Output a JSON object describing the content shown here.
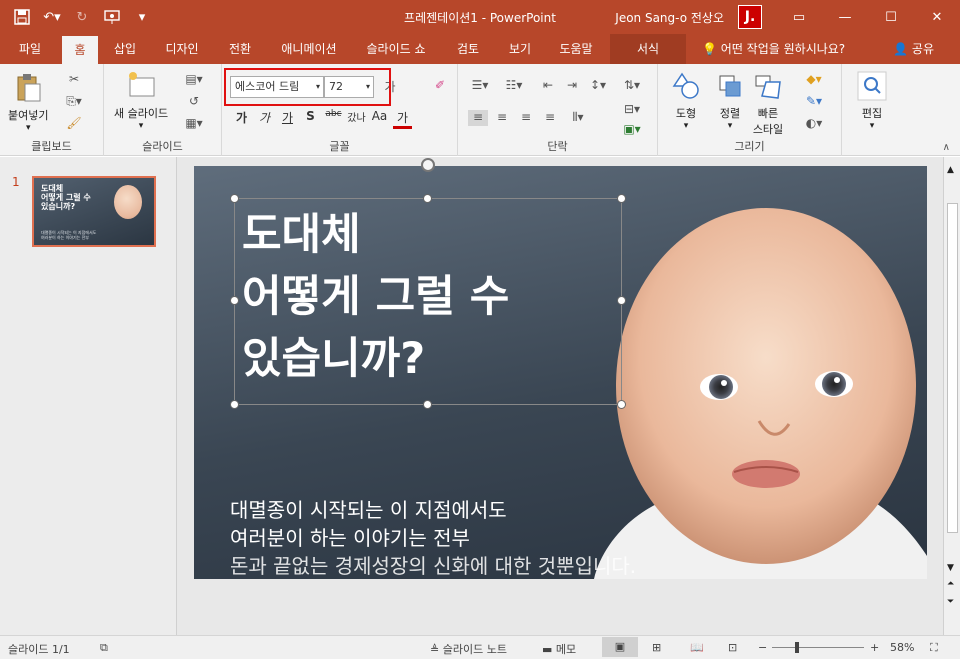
{
  "titlebar": {
    "qat": {
      "save_icon": "save-icon",
      "undo_icon": "undo-icon",
      "redo_icon": "redo-icon",
      "present_icon": "present-from-start-icon",
      "customize_icon": "customize-qat-icon"
    },
    "document_title": "프레젠테이션1 - PowerPoint",
    "user_name": "Jeon Sang-o 전상오",
    "avatar_letter": "J."
  },
  "tabs": [
    {
      "label": "파일"
    },
    {
      "label": "홈"
    },
    {
      "label": "삽입"
    },
    {
      "label": "디자인"
    },
    {
      "label": "전환"
    },
    {
      "label": "애니메이션"
    },
    {
      "label": "슬라이드 쇼"
    },
    {
      "label": "검토"
    },
    {
      "label": "보기"
    },
    {
      "label": "도움말"
    },
    {
      "label": "서식"
    }
  ],
  "tell_me": "어떤 작업을 원하시나요?",
  "share": "공유",
  "ribbon": {
    "clipboard": {
      "paste": "붙여넣기",
      "label": "클립보드"
    },
    "slides": {
      "new_slide": "새 슬라이드",
      "label": "슬라이드"
    },
    "font": {
      "font_name": "에스코어 드림",
      "font_size": "72",
      "label": "글꼴",
      "format_buttons": [
        "가",
        "가",
        "가",
        "S",
        "abc",
        "갔나",
        "Aa",
        "가"
      ]
    },
    "paragraph": {
      "label": "단락"
    },
    "drawing": {
      "shapes": "도형",
      "arrange": "정렬",
      "quick_styles_1": "빠른",
      "quick_styles_2": "스타일",
      "label": "그리기"
    },
    "editing": {
      "label": "편집"
    }
  },
  "thumbnails": {
    "number": "1",
    "title": "도대체\n어떻게 그럴 수\n있습니까?",
    "body": "대멸종이 시작되는 이 지점에서도\n여러분이 하는 이야기는 전부"
  },
  "slide": {
    "title_lines": [
      "도대체",
      "어떻게 그럴 수",
      "있습니까?"
    ],
    "body_lines": [
      "대멸종이 시작되는 이 지점에서도",
      "여러분이 하는 이야기는 전부",
      "돈과 끝없는 경제성장의 신화에 대한 것뿐입니다."
    ]
  },
  "statusbar": {
    "slide_count": "슬라이드 1/1",
    "notes": "슬라이드 노트",
    "comments": "메모",
    "zoom": "58%"
  },
  "colors": {
    "accent": "#b7472a",
    "highlight_box": "#e01010"
  }
}
